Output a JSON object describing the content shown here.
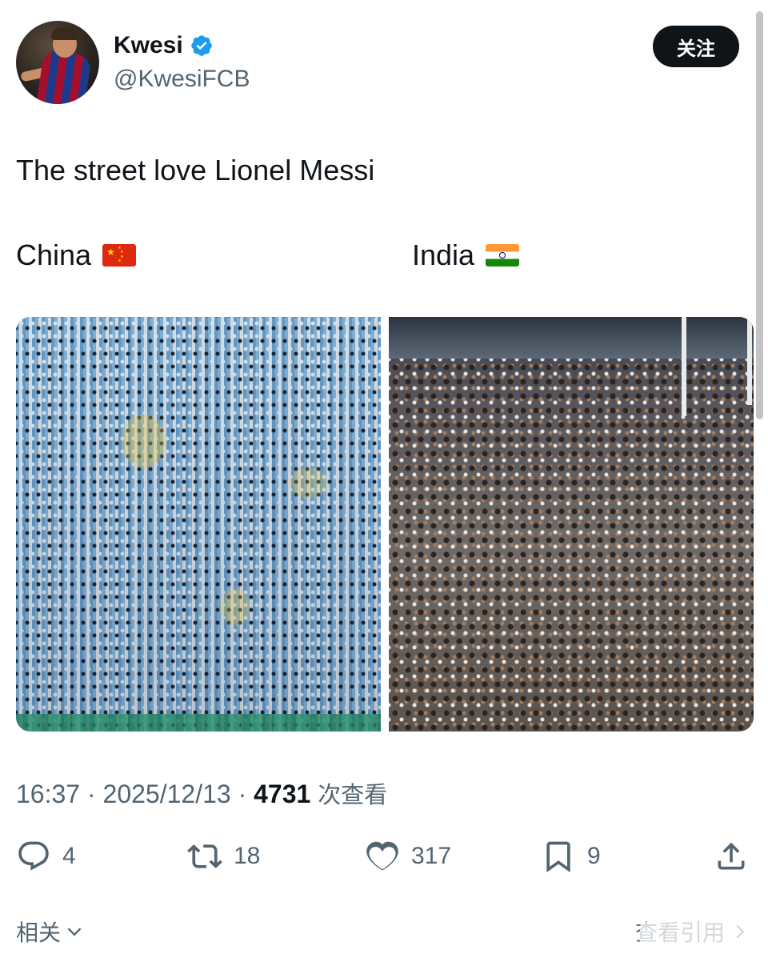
{
  "user": {
    "name": "Kwesi",
    "handle": "@KwesiFCB",
    "follow_label": "关注"
  },
  "tweet": {
    "text": "The street love Lionel Messi",
    "label_left": "China",
    "label_right": "India"
  },
  "meta": {
    "time": "16:37",
    "date": "2025/12/13",
    "views": "4731",
    "views_label": "次查看",
    "separator": "·"
  },
  "actions": {
    "replies": "4",
    "retweets": "18",
    "likes": "317",
    "bookmarks": "9"
  },
  "footer": {
    "related_label": "相关",
    "quotes_label": "查看引用"
  },
  "colors": {
    "text": "#0f1419",
    "secondary": "#536471",
    "verified": "#1d9bf0",
    "button_bg": "#0f1419"
  }
}
